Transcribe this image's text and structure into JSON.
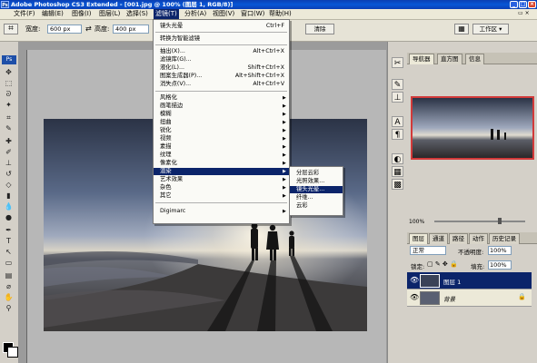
{
  "window": {
    "title": "Adobe Photoshop CS3 Extended - [001.jpg @ 100% (图层 1, RGB/8)]",
    "app_icon": "Ps"
  },
  "menubar": [
    "文件(F)",
    "编辑(E)",
    "图像(I)",
    "图层(L)",
    "选择(S)",
    "滤镜(T)",
    "分析(A)",
    "视图(V)",
    "窗口(W)",
    "帮助(H)"
  ],
  "options": {
    "width_label": "宽度:",
    "width_value": "600 px",
    "height_label": "高度:",
    "height_value": "400 px",
    "clear_button": "清除",
    "workspace": "工作区 ▾"
  },
  "filter_menu": {
    "items": [
      {
        "label": "镜头光晕",
        "shortcut": "Ctrl+F"
      },
      {
        "label": "转换为智能滤镜",
        "shortcut": ""
      },
      {
        "label": "抽出(X)...",
        "shortcut": "Alt+Ctrl+X"
      },
      {
        "label": "滤镜库(G)...",
        "shortcut": ""
      },
      {
        "label": "液化(L)...",
        "shortcut": "Shift+Ctrl+X"
      },
      {
        "label": "图案生成器(P)...",
        "shortcut": "Alt+Shift+Ctrl+X"
      },
      {
        "label": "消失点(V)...",
        "shortcut": "Alt+Ctrl+V"
      },
      {
        "label": "风格化",
        "shortcut": ""
      },
      {
        "label": "画笔描边",
        "shortcut": ""
      },
      {
        "label": "模糊",
        "shortcut": ""
      },
      {
        "label": "扭曲",
        "shortcut": ""
      },
      {
        "label": "锐化",
        "shortcut": ""
      },
      {
        "label": "视频",
        "shortcut": ""
      },
      {
        "label": "素描",
        "shortcut": ""
      },
      {
        "label": "纹理",
        "shortcut": ""
      },
      {
        "label": "像素化",
        "shortcut": ""
      },
      {
        "label": "渲染",
        "shortcut": ""
      },
      {
        "label": "艺术效果",
        "shortcut": ""
      },
      {
        "label": "杂色",
        "shortcut": ""
      },
      {
        "label": "其它",
        "shortcut": ""
      },
      {
        "label": "Digimarc",
        "shortcut": ""
      }
    ]
  },
  "render_submenu": {
    "items": [
      "分层云彩",
      "光照效果...",
      "镜头光晕...",
      "纤维...",
      "云彩"
    ]
  },
  "navigator": {
    "tabs": [
      "导航器",
      "直方图",
      "信息"
    ],
    "zoom": "100%"
  },
  "layers": {
    "tabs": [
      "图层",
      "通道",
      "路径",
      "动作",
      "历史记录"
    ],
    "blend_mode": "正常",
    "opacity_label": "不透明度:",
    "opacity_value": "100%",
    "lock_label": "锁定:",
    "fill_label": "填充:",
    "fill_value": "100%",
    "rows": [
      {
        "name": "图层 1",
        "selected": true
      },
      {
        "name": "背景",
        "selected": false
      }
    ]
  },
  "colors": {
    "accent": "#0b246a",
    "titlebar": "#0a3fb4"
  }
}
